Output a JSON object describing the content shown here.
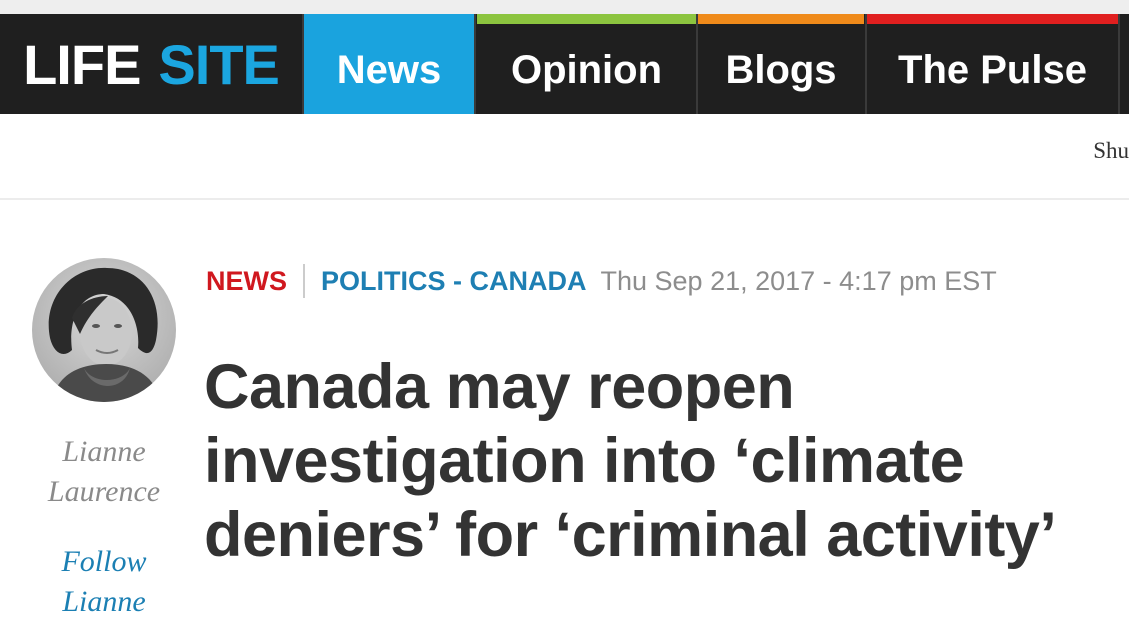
{
  "header": {
    "logo_part1": "LIFE",
    "logo_part2": "SITE",
    "nav": {
      "news": "News",
      "opinion": "Opinion",
      "blogs": "Blogs",
      "pulse": "The Pulse"
    },
    "nav_accent_colors": {
      "news": "#1aa3de",
      "opinion": "#8cc43f",
      "blogs": "#ef8a1a",
      "pulse": "#e01f1f"
    }
  },
  "subbar": {
    "right_text": "Shu"
  },
  "author": {
    "name_line1": "Lianne",
    "name_line2": "Laurence",
    "follow_line1": "Follow",
    "follow_line2": "Lianne"
  },
  "article": {
    "category": "NEWS",
    "subcategory": "POLITICS - CANADA",
    "date": "Thu Sep 21, 2017 - 4:17 pm EST",
    "title_line1": "Canada may reopen",
    "title_line2": "investigation into ‘climate",
    "title_line3": "deniers’ for ‘criminal activity’"
  }
}
